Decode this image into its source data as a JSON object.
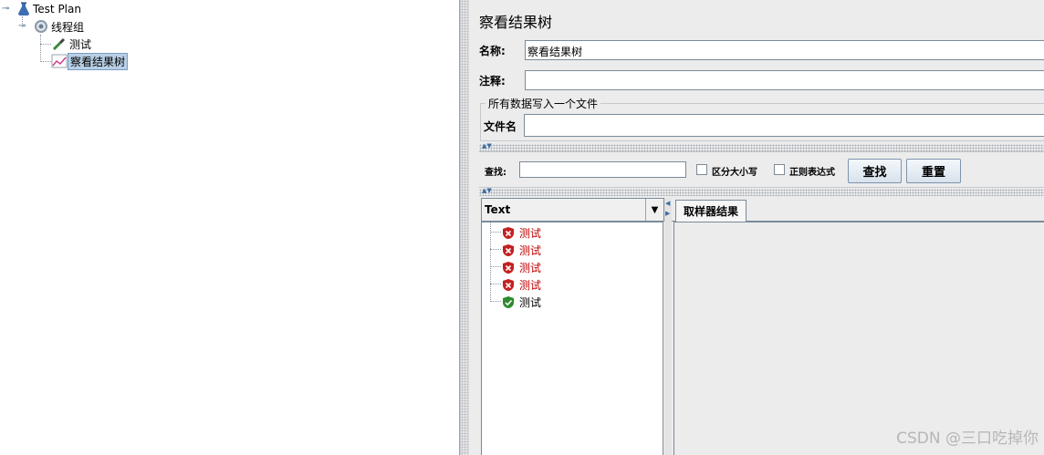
{
  "tree": {
    "root": "Test Plan",
    "thread_group": "线程组",
    "sampler": "测试",
    "listener": "察看结果树"
  },
  "panel": {
    "title": "察看结果树",
    "name_label": "名称:",
    "name_value": "察看结果树",
    "comment_label": "注释:",
    "comment_value": "",
    "group_title": "所有数据写入一个文件",
    "filename_label": "文件名",
    "filename_value": ""
  },
  "search": {
    "label": "查找:",
    "value": "",
    "case_label": "区分大小写",
    "regex_label": "正则表达式",
    "find_button": "查找",
    "reset_button": "重置"
  },
  "results": {
    "renderer": "Text",
    "items": [
      {
        "label": "测试",
        "status": "fail"
      },
      {
        "label": "测试",
        "status": "fail"
      },
      {
        "label": "测试",
        "status": "fail"
      },
      {
        "label": "测试",
        "status": "fail"
      },
      {
        "label": "测试",
        "status": "ok"
      }
    ],
    "tab_label": "取样器结果"
  },
  "watermark": "CSDN @三口吃掉你",
  "colors": {
    "fail": "#c00000",
    "ok": "#2e8b2e",
    "selection": "#b8cfe5"
  }
}
